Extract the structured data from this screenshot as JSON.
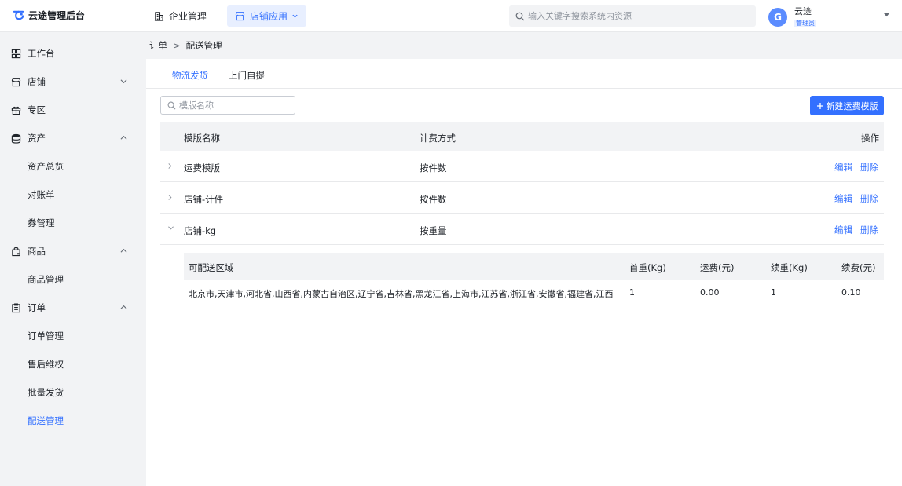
{
  "app": {
    "title": "云途管理后台"
  },
  "topnav": [
    {
      "label": "企业管理",
      "icon": "building-icon",
      "active": false
    },
    {
      "label": "店铺应用",
      "icon": "store-icon",
      "active": true
    }
  ],
  "search": {
    "placeholder": "输入关键字搜索系统内资源"
  },
  "user": {
    "avatar_letter": "G",
    "name": "云途",
    "role": "管理员"
  },
  "sidebar": {
    "items": [
      {
        "label": "工作台",
        "icon": "grid-icon"
      },
      {
        "label": "店铺",
        "icon": "shop-icon",
        "arrow": "down"
      },
      {
        "label": "专区",
        "icon": "gift-icon"
      },
      {
        "label": "资产",
        "icon": "database-icon",
        "arrow": "up"
      },
      {
        "label": "商品",
        "icon": "bag-icon",
        "arrow": "up"
      },
      {
        "label": "订单",
        "icon": "clipboard-icon",
        "arrow": "up"
      }
    ],
    "asset_subs": [
      "资产总览",
      "对账单",
      "券管理"
    ],
    "goods_subs": [
      "商品管理"
    ],
    "order_subs": [
      "订单管理",
      "售后维权",
      "批量发货",
      "配送管理"
    ],
    "active_sub": "配送管理"
  },
  "breadcrumb": {
    "parent": "订单",
    "sep": ">",
    "current": "配送管理"
  },
  "tabs": [
    {
      "label": "物流发货",
      "active": true
    },
    {
      "label": "上门自提",
      "active": false
    }
  ],
  "filter": {
    "placeholder": "模版名称"
  },
  "new_button": {
    "label": "新建运费模版"
  },
  "table": {
    "columns": [
      "模版名称",
      "计费方式",
      "操作"
    ],
    "rows": [
      {
        "name": "运费模版",
        "billing": "按件数",
        "expanded": false
      },
      {
        "name": "店铺-计件",
        "billing": "按件数",
        "expanded": false
      },
      {
        "name": "店铺-kg",
        "billing": "按重量",
        "expanded": true
      }
    ],
    "actions": {
      "edit": "编辑",
      "delete": "删除"
    }
  },
  "detail": {
    "columns": [
      "可配送区域",
      "首重(Kg)",
      "运费(元)",
      "续重(Kg)",
      "续费(元)"
    ],
    "rows": [
      {
        "region": "北京市,天津市,河北省,山西省,内蒙古自治区,辽宁省,吉林省,黑龙江省,上海市,江苏省,浙江省,安徽省,福建省,江西省,...",
        "first_weight": "1",
        "fee": "0.00",
        "extra_weight": "1",
        "extra_fee": "0.10"
      }
    ]
  },
  "colors": {
    "accent": "#3370ff",
    "accent_light": "#e8efff",
    "bg": "#f2f3f5"
  }
}
